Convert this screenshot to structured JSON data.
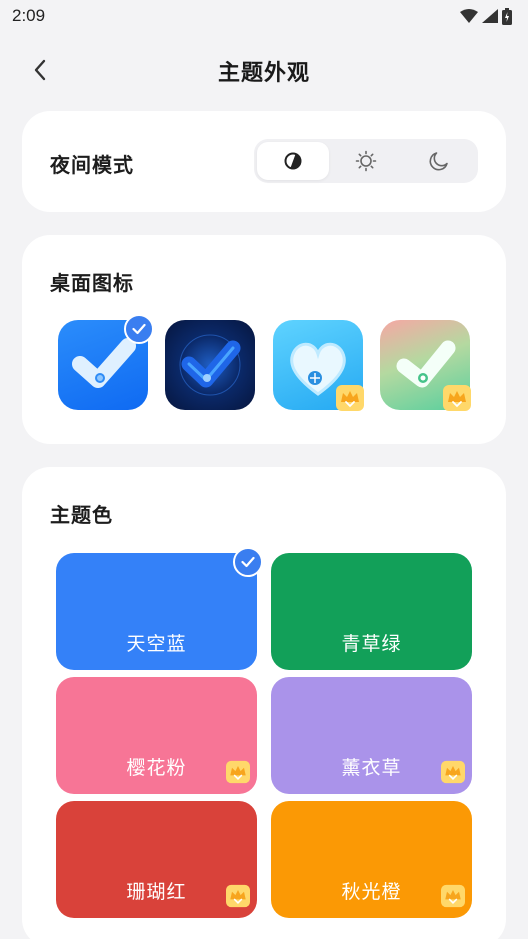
{
  "status_bar": {
    "time": "2:09"
  },
  "header": {
    "title": "主题外观"
  },
  "night_mode": {
    "title": "夜间模式",
    "options": [
      {
        "icon": "auto-contrast-icon",
        "selected": true
      },
      {
        "icon": "sun-icon",
        "selected": false
      },
      {
        "icon": "moon-icon",
        "selected": false
      }
    ]
  },
  "desktop_icons": {
    "title": "桌面图标",
    "items": [
      {
        "style": "blue-classic",
        "selected": true,
        "premium": false
      },
      {
        "style": "dark-neon",
        "selected": false,
        "premium": false
      },
      {
        "style": "ice-heart",
        "selected": false,
        "premium": true
      },
      {
        "style": "pastel-gradient",
        "selected": false,
        "premium": true
      }
    ]
  },
  "theme_color": {
    "title": "主题色",
    "swatches": [
      {
        "label": "天空蓝",
        "color": "#3481f8",
        "selected": true,
        "premium": false
      },
      {
        "label": "青草绿",
        "color": "#12a059",
        "selected": false,
        "premium": false
      },
      {
        "label": "樱花粉",
        "color": "#f77596",
        "selected": false,
        "premium": true
      },
      {
        "label": "薰衣草",
        "color": "#aa93ea",
        "selected": false,
        "premium": true
      },
      {
        "label": "珊瑚红",
        "color": "#d9423a",
        "selected": false,
        "premium": true
      },
      {
        "label": "秋光橙",
        "color": "#fb9905",
        "selected": false,
        "premium": true
      }
    ]
  }
}
